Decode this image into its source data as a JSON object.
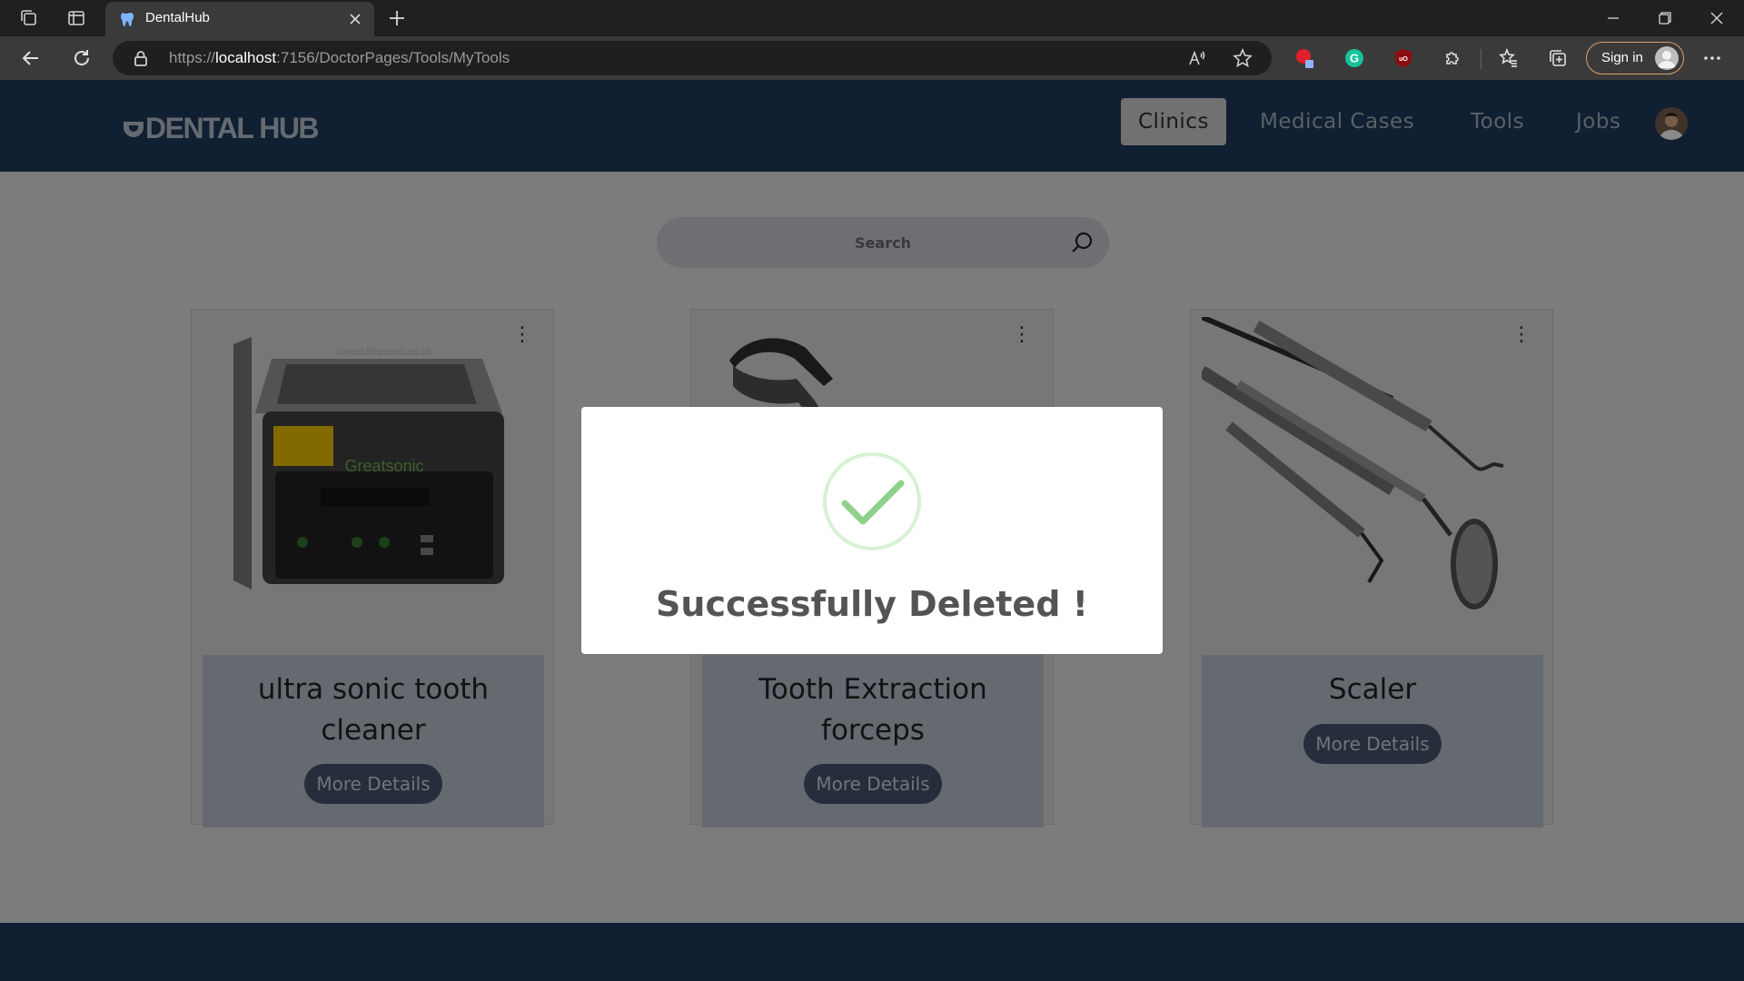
{
  "browser": {
    "tab_title": "DentalHub",
    "url_scheme": "https://",
    "url_host": "localhost",
    "url_path": ":7156/DoctorPages/Tools/MyTools",
    "signin_label": "Sign in"
  },
  "navbar": {
    "logo": "DENTAL HUB",
    "links": [
      "Clinics",
      "Medical Cases",
      "Tools",
      "Jobs"
    ],
    "active_link": "Clinics"
  },
  "search": {
    "placeholder": "Search"
  },
  "cards": [
    {
      "title_line1": "ultra sonic tooth",
      "title_line2": "cleaner",
      "button": "More Details",
      "image": "ultrasonic-cleaner",
      "image_brand": "Greatsonic",
      "image_watermark": "GreatUltrasonic.co.uk"
    },
    {
      "title_line1": "Tooth Extraction",
      "title_line2": "forceps",
      "button": "More Details",
      "image": "extraction-forceps"
    },
    {
      "title_line1": "Scaler",
      "title_line2": "",
      "button": "More Details",
      "image": "dental-instruments"
    }
  ],
  "modal": {
    "message": "Successfully Deleted !"
  },
  "colors": {
    "navbar": "#1c3454",
    "button": "#3f4d62",
    "success": "#8fd18a"
  }
}
